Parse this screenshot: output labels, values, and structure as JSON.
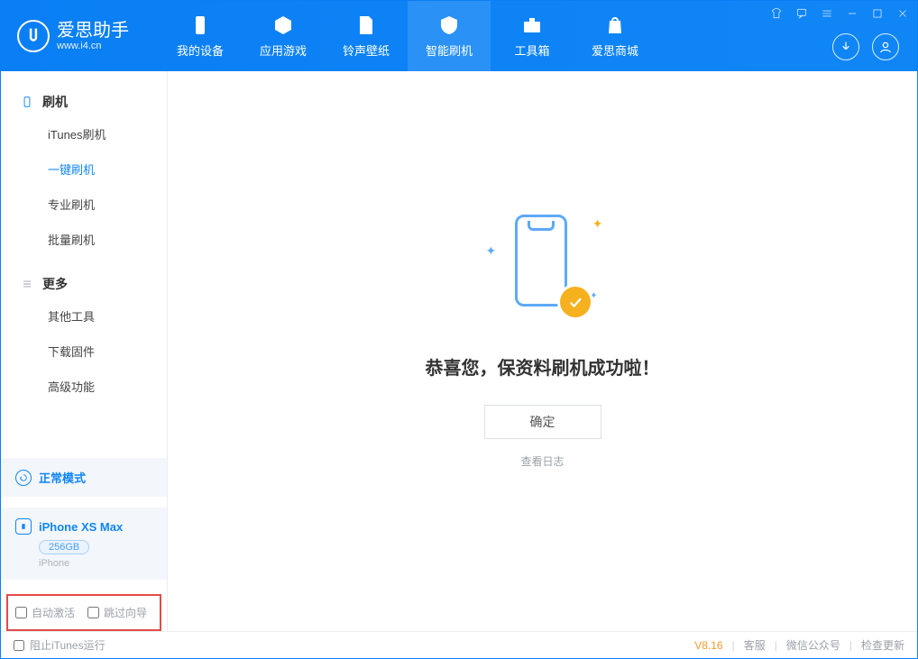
{
  "app": {
    "name": "爱思助手",
    "url": "www.i4.cn"
  },
  "nav": {
    "tabs": [
      {
        "label": "我的设备",
        "icon": "device"
      },
      {
        "label": "应用游戏",
        "icon": "cube"
      },
      {
        "label": "铃声壁纸",
        "icon": "music"
      },
      {
        "label": "智能刷机",
        "icon": "refresh",
        "active": true
      },
      {
        "label": "工具箱",
        "icon": "toolbox"
      },
      {
        "label": "爱思商城",
        "icon": "bag"
      }
    ]
  },
  "sidebar": {
    "group1_title": "刷机",
    "group1_items": [
      "iTunes刷机",
      "一键刷机",
      "专业刷机",
      "批量刷机"
    ],
    "group1_active_index": 1,
    "group2_title": "更多",
    "group2_items": [
      "其他工具",
      "下载固件",
      "高级功能"
    ],
    "mode_label": "正常模式",
    "device_name": "iPhone XS Max",
    "device_capacity": "256GB",
    "device_type": "iPhone",
    "checkbox1_label": "自动激活",
    "checkbox2_label": "跳过向导"
  },
  "main": {
    "success_message": "恭喜您，保资料刷机成功啦！",
    "ok_button": "确定",
    "view_log": "查看日志"
  },
  "footer": {
    "stop_itunes": "阻止iTunes运行",
    "version": "V8.16",
    "links": [
      "客服",
      "微信公众号",
      "检查更新"
    ]
  }
}
